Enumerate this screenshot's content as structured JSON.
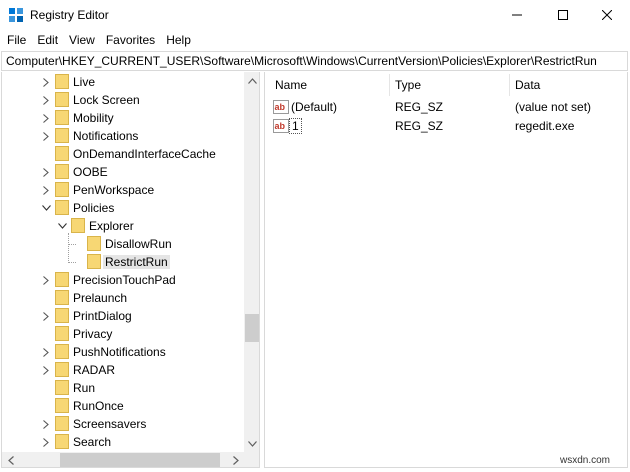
{
  "window": {
    "title": "Registry Editor",
    "controls": {
      "minimize": "minimize-icon",
      "maximize": "maximize-icon",
      "close": "close-icon"
    }
  },
  "menu": [
    "File",
    "Edit",
    "View",
    "Favorites",
    "Help"
  ],
  "address": "Computer\\HKEY_CURRENT_USER\\Software\\Microsoft\\Windows\\CurrentVersion\\Policies\\Explorer\\RestrictRun",
  "tree": {
    "items": [
      {
        "label": "Live",
        "expander": "collapsed"
      },
      {
        "label": "Lock Screen",
        "expander": "collapsed"
      },
      {
        "label": "Mobility",
        "expander": "collapsed"
      },
      {
        "label": "Notifications",
        "expander": "collapsed"
      },
      {
        "label": "OnDemandInterfaceCache",
        "expander": "none"
      },
      {
        "label": "OOBE",
        "expander": "collapsed"
      },
      {
        "label": "PenWorkspace",
        "expander": "collapsed"
      },
      {
        "label": "Policies",
        "expander": "expanded"
      },
      {
        "label": "Explorer",
        "expander": "expanded"
      },
      {
        "label": "DisallowRun",
        "expander": "none"
      },
      {
        "label": "RestrictRun",
        "expander": "none",
        "selected": true
      },
      {
        "label": "PrecisionTouchPad",
        "expander": "collapsed"
      },
      {
        "label": "Prelaunch",
        "expander": "none"
      },
      {
        "label": "PrintDialog",
        "expander": "collapsed"
      },
      {
        "label": "Privacy",
        "expander": "none"
      },
      {
        "label": "PushNotifications",
        "expander": "collapsed"
      },
      {
        "label": "RADAR",
        "expander": "collapsed"
      },
      {
        "label": "Run",
        "expander": "none"
      },
      {
        "label": "RunOnce",
        "expander": "none"
      },
      {
        "label": "Screensavers",
        "expander": "collapsed"
      },
      {
        "label": "Search",
        "expander": "collapsed"
      }
    ]
  },
  "values": {
    "columns": [
      "Name",
      "Type",
      "Data"
    ],
    "rows": [
      {
        "name": "(Default)",
        "type": "REG_SZ",
        "data": "(value not set)",
        "icon": "string-value-icon"
      },
      {
        "name": "1",
        "type": "REG_SZ",
        "data": "regedit.exe",
        "icon": "string-value-icon",
        "editing": true
      }
    ]
  },
  "colors": {
    "folder": "#f7d774",
    "folder_edge": "#d9b44a",
    "selection": "#e5e5e5",
    "accent": "#0078d7",
    "string_icon": "#c0392b"
  },
  "watermark": "wsxdn.com"
}
